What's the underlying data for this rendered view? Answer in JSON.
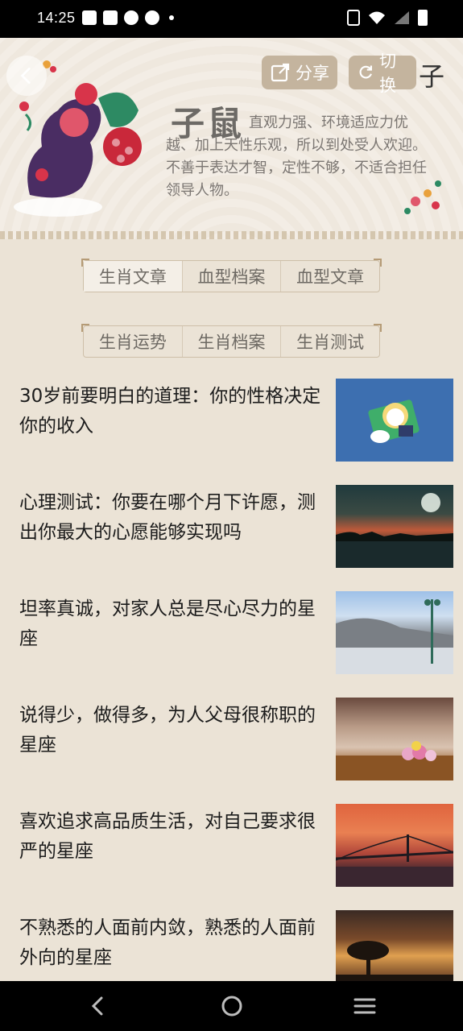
{
  "status_bar": {
    "time": "14:25"
  },
  "header": {
    "share_label": "分享",
    "switch_label": "切换",
    "zodiac_name": "子鼠",
    "zodiac_description": "直观力强、环境适应力优越、加上天性乐观，所以到处受人欢迎。不善于表达才智，定性不够，不适合担任领导人物。",
    "logo_glyph": "子"
  },
  "tabs_row1": [
    {
      "label": "生肖文章",
      "active": true
    },
    {
      "label": "血型档案",
      "active": false
    },
    {
      "label": "血型文章",
      "active": false
    }
  ],
  "tabs_row2": [
    {
      "label": "生肖运势",
      "active": false
    },
    {
      "label": "生肖档案",
      "active": false
    },
    {
      "label": "生肖测试",
      "active": false
    }
  ],
  "articles": [
    {
      "title": "30岁前要明白的道理：你的性格决定你的收入",
      "thumb": "cartoon-illustration"
    },
    {
      "title": "心理测试：你要在哪个月下许愿，测出你最大的心愿能够实现吗",
      "thumb": "sunset-lake-moon"
    },
    {
      "title": "坦率真诚，对家人总是尽心尽力的星座",
      "thumb": "snowy-town-streetlamp"
    },
    {
      "title": "说得少，做得多，为人父母很称职的星座",
      "thumb": "flowers-on-table"
    },
    {
      "title": "喜欢追求高品质生活，对自己要求很严的星座",
      "thumb": "bridge-sunset"
    },
    {
      "title": "不熟悉的人面前内敛，熟悉的人面前外向的星座",
      "thumb": "tree-sunset"
    }
  ],
  "colors": {
    "background": "#ebe3d6",
    "header_button": "#c4b49e",
    "title_text": "#1b1b1b"
  }
}
